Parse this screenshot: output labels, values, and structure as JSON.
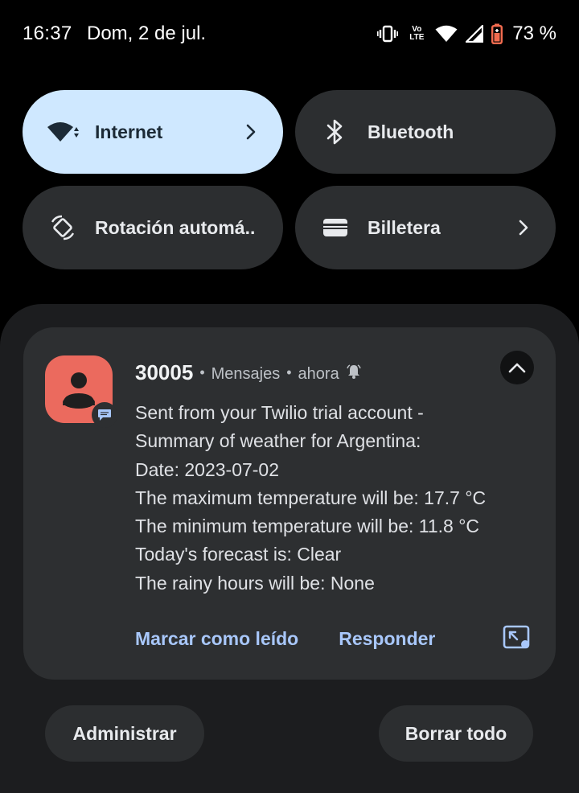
{
  "status_bar": {
    "time": "16:37",
    "date": "Dom, 2 de jul.",
    "battery_percent": "73 %",
    "volte_label_top": "Vo",
    "volte_label_bottom": "LTE",
    "icons": [
      "vibrate-icon",
      "volte-icon",
      "wifi-icon",
      "cell-signal-icon",
      "battery-saver-icon"
    ]
  },
  "quick_settings": {
    "tiles": [
      {
        "label": "Internet",
        "icon": "wifi-icon",
        "active": true,
        "has_chevron": true
      },
      {
        "label": "Bluetooth",
        "icon": "bluetooth-icon",
        "active": false,
        "has_chevron": false
      },
      {
        "label": "Rotación automá..",
        "icon": "auto-rotate-icon",
        "active": false,
        "has_chevron": false
      },
      {
        "label": "Billetera",
        "icon": "wallet-icon",
        "active": false,
        "has_chevron": true
      }
    ]
  },
  "notification": {
    "sender": "30005",
    "app": "Mensajes",
    "time": "ahora",
    "lines": [
      "Sent from your Twilio trial account -",
      "Summary of weather for Argentina:",
      "Date: 2023-07-02",
      "The maximum temperature will be: 17.7 °C",
      "The minimum temperature will be: 11.8 °C",
      "Today's forecast is: Clear",
      "The rainy hours will be: None"
    ],
    "actions": {
      "mark_read": "Marcar como leído",
      "reply": "Responder"
    }
  },
  "footer": {
    "manage_label": "Administrar",
    "clear_all_label": "Borrar todo"
  },
  "colors": {
    "background": "#000000",
    "tile": "#2c2e30",
    "tile_active": "#cfe8ff",
    "card": "#2d2f31",
    "avatar": "#eb6a5e",
    "action_text": "#a8c7fa",
    "battery_accent": "#f26b4f"
  }
}
